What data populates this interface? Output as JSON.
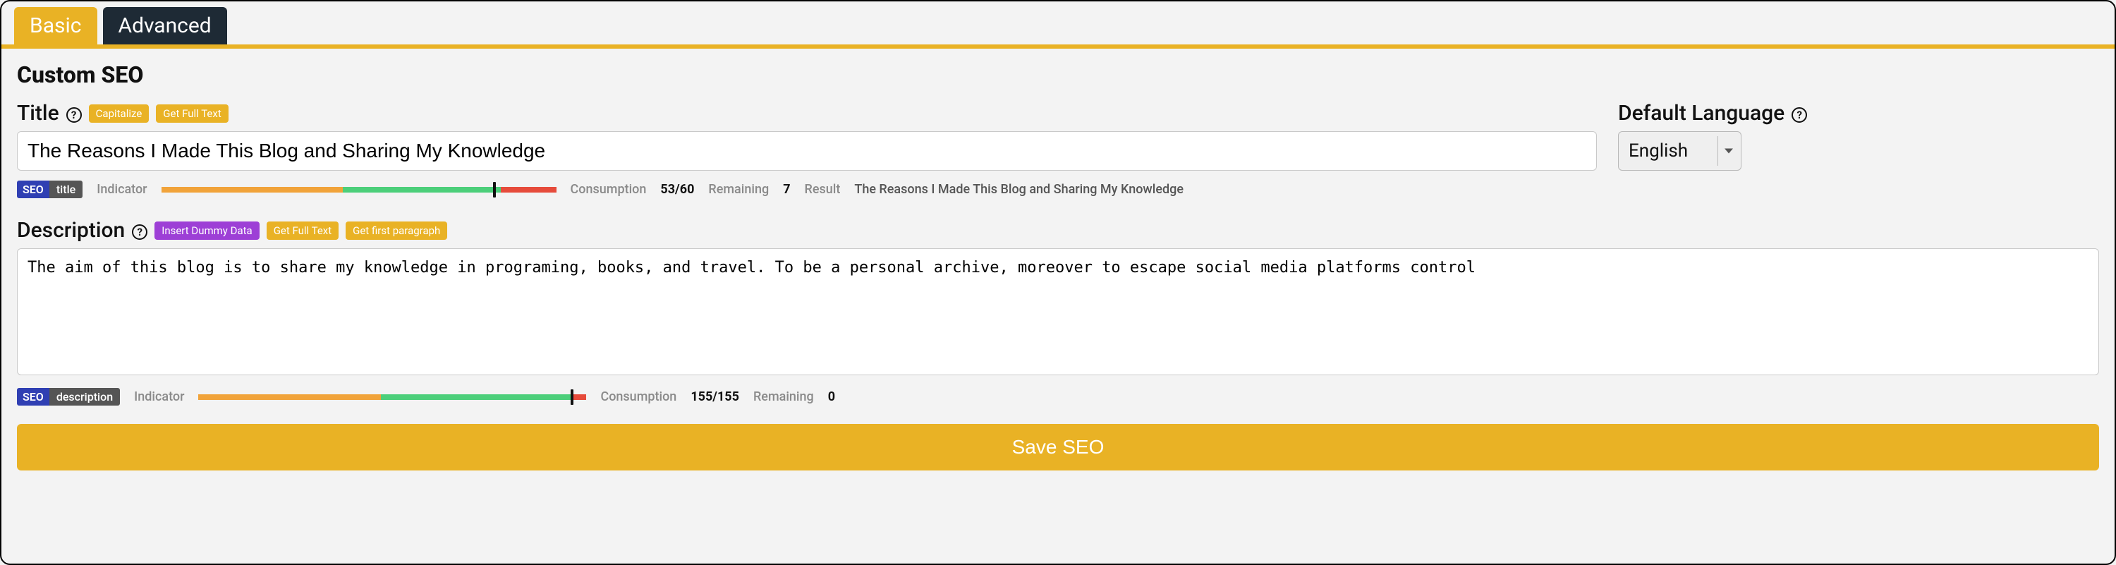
{
  "colors": {
    "accent": "#e9b225",
    "dark": "#1e2a35",
    "purple": "#9d3fd6",
    "seo_blue": "#2f3fb3",
    "bar_orange": "#f1a33a",
    "bar_green": "#4ccf7a",
    "bar_red": "#e64b3b"
  },
  "tabs": {
    "basic": "Basic",
    "advanced": "Advanced"
  },
  "section_title": "Custom SEO",
  "title": {
    "label": "Title",
    "help_glyph": "?",
    "capitalize": "Capitalize",
    "get_full_text": "Get Full Text",
    "value": "The Reasons I Made This Blog and Sharing My Knowledge",
    "seo_tag_left": "SEO",
    "seo_tag_right": "title",
    "indicator_label": "Indicator",
    "consumption_label": "Consumption",
    "consumption_value": "53/60",
    "remaining_label": "Remaining",
    "remaining_value": "7",
    "result_label": "Result",
    "result_value": "The Reasons I Made This Blog and Sharing My Knowledge"
  },
  "language": {
    "label": "Default Language",
    "help_glyph": "?",
    "selected": "English"
  },
  "description": {
    "label": "Description",
    "help_glyph": "?",
    "insert_dummy": "Insert Dummy Data",
    "get_full_text": "Get Full Text",
    "get_first_paragraph": "Get first paragraph",
    "value": "The aim of this blog is to share my knowledge in programing, books, and travel. To be a personal archive, moreover to escape social media platforms control",
    "seo_tag_left": "SEO",
    "seo_tag_right": "description",
    "indicator_label": "Indicator",
    "consumption_label": "Consumption",
    "consumption_value": "155/155",
    "remaining_label": "Remaining",
    "remaining_value": "0"
  },
  "save_label": "Save SEO"
}
